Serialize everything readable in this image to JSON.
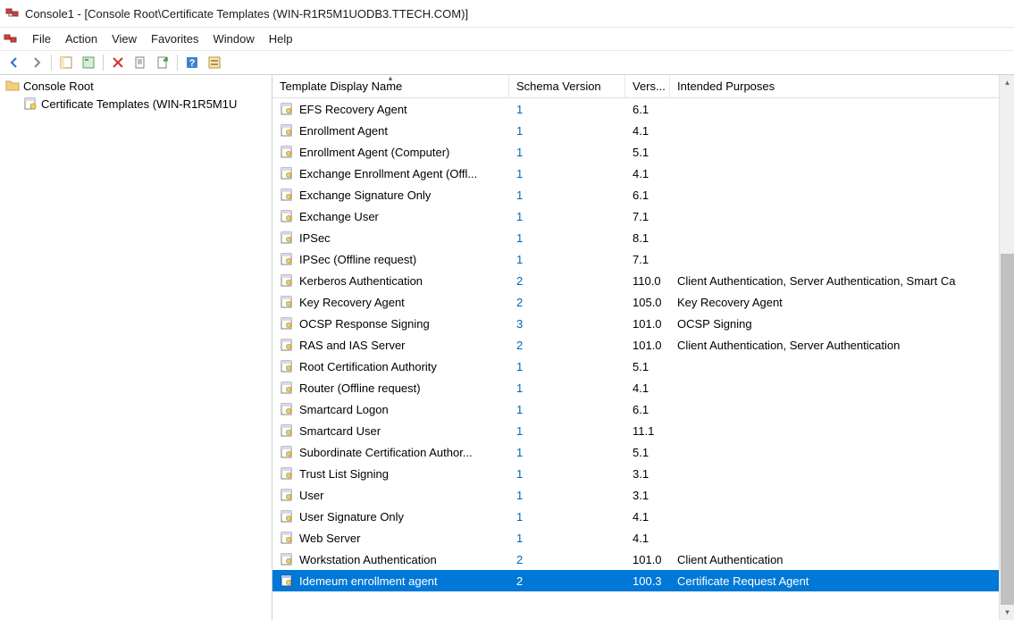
{
  "window": {
    "title": "Console1 - [Console Root\\Certificate Templates (WIN-R1R5M1UODB3.TTECH.COM)]"
  },
  "menu": {
    "items": [
      "File",
      "Action",
      "View",
      "Favorites",
      "Window",
      "Help"
    ]
  },
  "tree": {
    "root": "Console Root",
    "child": "Certificate Templates (WIN-R1R5M1U"
  },
  "columns": {
    "name": "Template Display Name",
    "schema": "Schema Version",
    "version": "Vers...",
    "purposes": "Intended Purposes"
  },
  "rows": [
    {
      "name": "EFS Recovery Agent",
      "schema": "1",
      "version": "6.1",
      "purposes": "",
      "selected": false
    },
    {
      "name": "Enrollment Agent",
      "schema": "1",
      "version": "4.1",
      "purposes": "",
      "selected": false
    },
    {
      "name": "Enrollment Agent (Computer)",
      "schema": "1",
      "version": "5.1",
      "purposes": "",
      "selected": false
    },
    {
      "name": "Exchange Enrollment Agent (Offl...",
      "schema": "1",
      "version": "4.1",
      "purposes": "",
      "selected": false
    },
    {
      "name": "Exchange Signature Only",
      "schema": "1",
      "version": "6.1",
      "purposes": "",
      "selected": false
    },
    {
      "name": "Exchange User",
      "schema": "1",
      "version": "7.1",
      "purposes": "",
      "selected": false
    },
    {
      "name": "IPSec",
      "schema": "1",
      "version": "8.1",
      "purposes": "",
      "selected": false
    },
    {
      "name": "IPSec (Offline request)",
      "schema": "1",
      "version": "7.1",
      "purposes": "",
      "selected": false
    },
    {
      "name": "Kerberos Authentication",
      "schema": "2",
      "version": "110.0",
      "purposes": "Client Authentication, Server Authentication, Smart Ca",
      "selected": false
    },
    {
      "name": "Key Recovery Agent",
      "schema": "2",
      "version": "105.0",
      "purposes": "Key Recovery Agent",
      "selected": false
    },
    {
      "name": "OCSP Response Signing",
      "schema": "3",
      "version": "101.0",
      "purposes": "OCSP Signing",
      "selected": false
    },
    {
      "name": "RAS and IAS Server",
      "schema": "2",
      "version": "101.0",
      "purposes": "Client Authentication, Server Authentication",
      "selected": false
    },
    {
      "name": "Root Certification Authority",
      "schema": "1",
      "version": "5.1",
      "purposes": "",
      "selected": false
    },
    {
      "name": "Router (Offline request)",
      "schema": "1",
      "version": "4.1",
      "purposes": "",
      "selected": false
    },
    {
      "name": "Smartcard Logon",
      "schema": "1",
      "version": "6.1",
      "purposes": "",
      "selected": false
    },
    {
      "name": "Smartcard User",
      "schema": "1",
      "version": "11.1",
      "purposes": "",
      "selected": false
    },
    {
      "name": "Subordinate Certification Author...",
      "schema": "1",
      "version": "5.1",
      "purposes": "",
      "selected": false
    },
    {
      "name": "Trust List Signing",
      "schema": "1",
      "version": "3.1",
      "purposes": "",
      "selected": false
    },
    {
      "name": "User",
      "schema": "1",
      "version": "3.1",
      "purposes": "",
      "selected": false
    },
    {
      "name": "User Signature Only",
      "schema": "1",
      "version": "4.1",
      "purposes": "",
      "selected": false
    },
    {
      "name": "Web Server",
      "schema": "1",
      "version": "4.1",
      "purposes": "",
      "selected": false
    },
    {
      "name": "Workstation Authentication",
      "schema": "2",
      "version": "101.0",
      "purposes": "Client Authentication",
      "selected": false
    },
    {
      "name": "Idemeum enrollment agent",
      "schema": "2",
      "version": "100.3",
      "purposes": "Certificate Request Agent",
      "selected": true
    }
  ]
}
